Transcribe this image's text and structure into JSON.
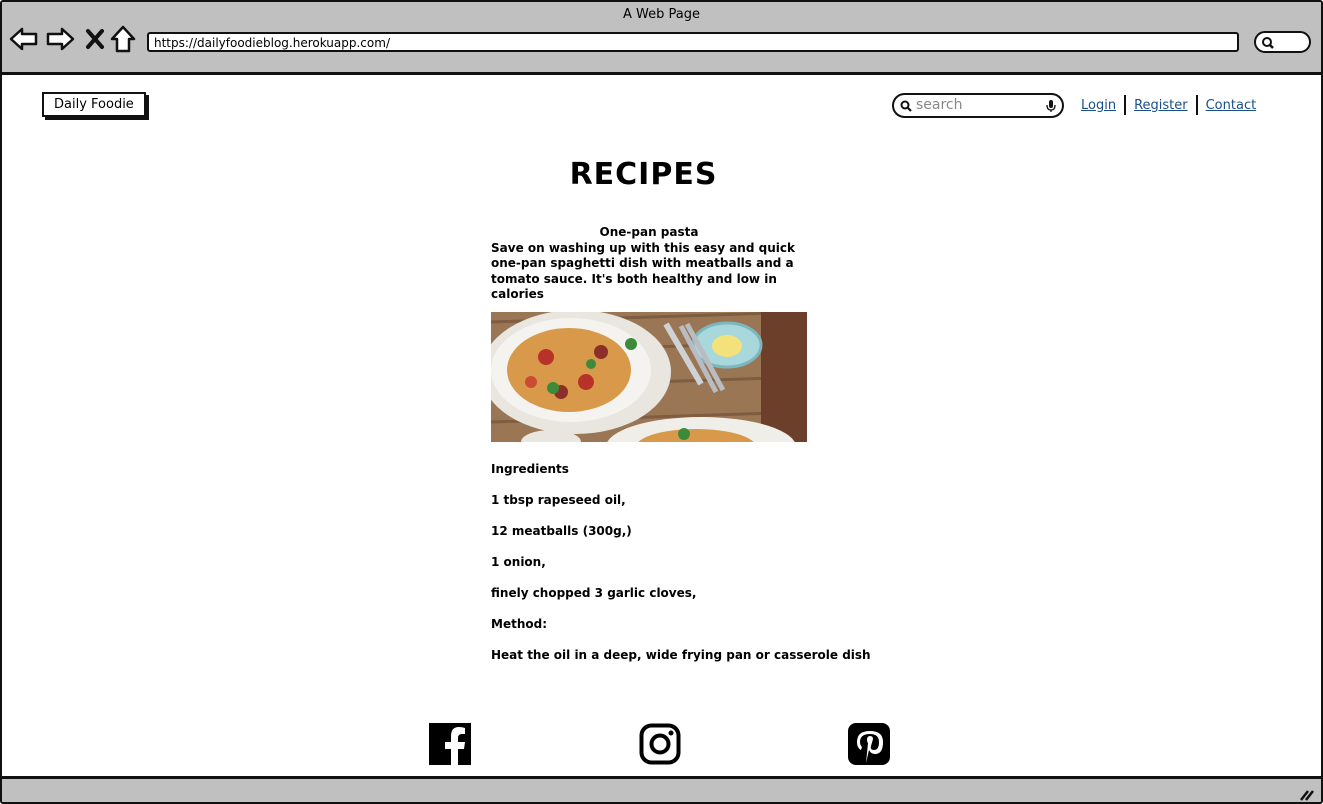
{
  "browser": {
    "window_title": "A Web Page",
    "url": "https://dailyfoodieblog.herokuapp.com/",
    "icons": [
      "back-arrow-icon",
      "forward-arrow-icon",
      "close-icon",
      "home-icon",
      "search-icon"
    ]
  },
  "header": {
    "logo": "Daily Foodie",
    "search_placeholder": "search",
    "links": [
      "Login",
      "Register",
      "Contact"
    ]
  },
  "main": {
    "heading": "RECIPES",
    "recipe": {
      "title": "One-pan pasta",
      "description": "Save on washing up with this easy and quick one-pan spaghetti dish with meatballs and a tomato sauce. It's both healthy and low in calories",
      "lines": [
        "Ingredients",
        "1 tbsp rapeseed oil,",
        "12 meatballs (300g,)",
        "1 onion,",
        "finely chopped 3 garlic cloves,",
        "Method:",
        "Heat the oil in a deep, wide frying pan or casserole dish"
      ]
    }
  },
  "footer": {
    "social_icons": [
      "facebook-icon",
      "instagram-icon",
      "pinterest-icon"
    ]
  }
}
